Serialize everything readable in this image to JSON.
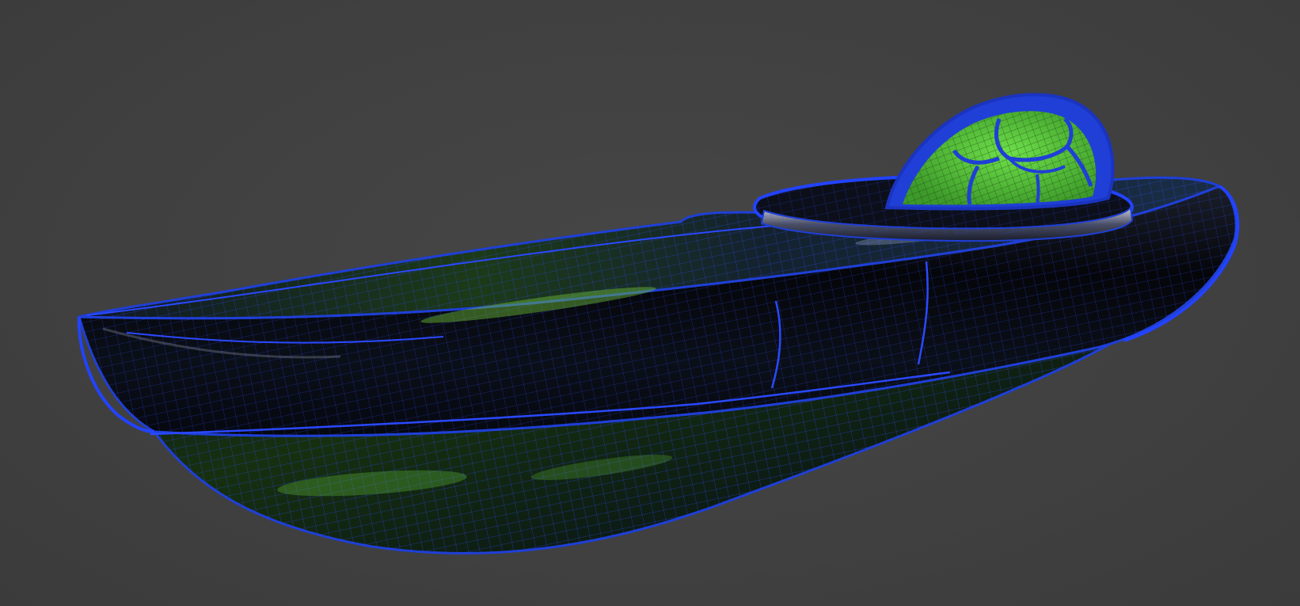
{
  "viewport": {
    "background_color": "#414141",
    "render_mode": "wireframe-overlay"
  },
  "model": {
    "object_type": "kayak",
    "wire_color": "#1f3fd6",
    "hull_color": "#0a0c14",
    "seat_color": "#5fd03a",
    "deck_glint_color": "#6fbf3a"
  }
}
